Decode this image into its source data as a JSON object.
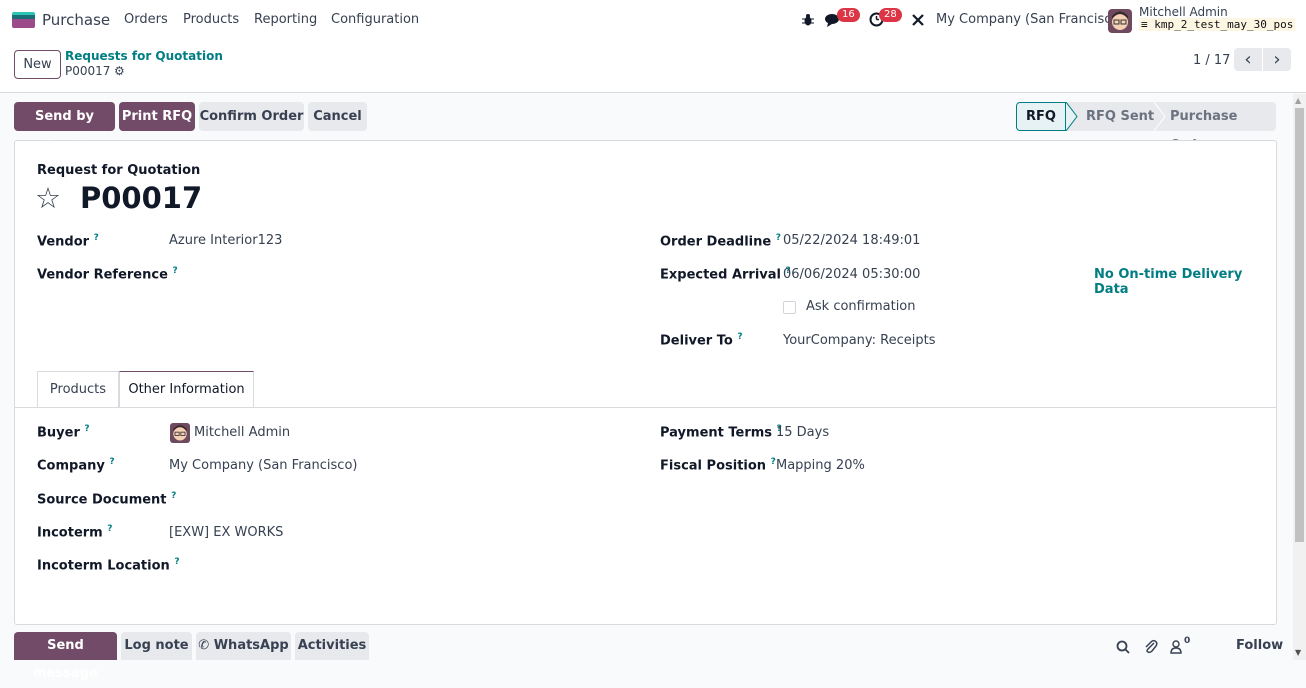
{
  "navbar": {
    "app_name": "Purchase",
    "menus": [
      "Orders",
      "Products",
      "Reporting",
      "Configuration"
    ],
    "messages_count": "16",
    "activities_count": "28",
    "company": "My Company (San Francisco)",
    "user_name": "Mitchell Admin",
    "database": "kmp_2_test_may_30_pos"
  },
  "control": {
    "new_label": "New",
    "breadcrumb_parent": "Requests for Quotation",
    "breadcrumb_current": "P00017",
    "pager": "1 / 17"
  },
  "actions": {
    "send_email": "Send by Email",
    "print_rfq": "Print RFQ",
    "confirm_order": "Confirm Order",
    "cancel": "Cancel"
  },
  "status": {
    "stages": [
      "RFQ",
      "RFQ Sent",
      "Purchase Order"
    ],
    "current": "RFQ"
  },
  "form": {
    "doc_type": "Request for Quotation",
    "name": "P00017",
    "vendor_label": "Vendor",
    "vendor": "Azure Interior123",
    "vendor_ref_label": "Vendor Reference",
    "vendor_ref": "",
    "order_deadline_label": "Order Deadline",
    "order_deadline": "05/22/2024 18:49:01",
    "expected_arrival_label": "Expected Arrival",
    "expected_arrival": "06/06/2024 05:30:00",
    "ontime_label": "No On-time Delivery Data",
    "ask_confirmation_label": "Ask confirmation",
    "ask_confirmation": false,
    "deliver_to_label": "Deliver To",
    "deliver_to": "YourCompany: Receipts",
    "help_mark": "?"
  },
  "tabs": [
    {
      "label": "Products",
      "active": false
    },
    {
      "label": "Other Information",
      "active": true
    }
  ],
  "other_info": {
    "buyer_label": "Buyer",
    "buyer": "Mitchell Admin",
    "company_label": "Company",
    "company": "My Company (San Francisco)",
    "source_doc_label": "Source Document",
    "source_doc": "",
    "incoterm_label": "Incoterm",
    "incoterm": "[EXW] EX WORKS",
    "incoterm_loc_label": "Incoterm Location",
    "incoterm_loc": "",
    "payment_terms_label": "Payment Terms",
    "payment_terms": "15 Days",
    "fiscal_position_label": "Fiscal Position",
    "fiscal_position": "Mapping 20%"
  },
  "chatter": {
    "send_message": "Send message",
    "log_note": "Log note",
    "whatsapp": "WhatsApp",
    "activities": "Activities",
    "followers_count": "0",
    "follow": "Follow"
  },
  "icons": {
    "star": "☆",
    "gear": "⚙",
    "prev": "‹",
    "next": "›",
    "bug": "🐞",
    "wrench": "✕",
    "search": "⌕",
    "paperclip": "📎",
    "user": "👤",
    "whatsapp": "✆"
  }
}
